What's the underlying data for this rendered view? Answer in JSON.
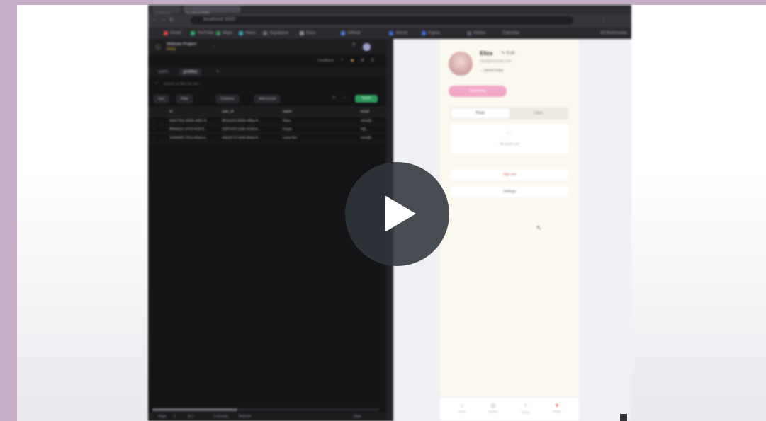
{
  "browser": {
    "address": "localhost:3000",
    "tabs": [
      "supabase",
      "localhost:3000"
    ],
    "bookmarks": [
      "Gmail",
      "YouTube",
      "Maps",
      "News",
      "Supabase",
      "Docs",
      "GitHub",
      "Vercel",
      "Figma",
      "Notion",
      "Calendar"
    ],
    "bookmarks_more": "All Bookmarks"
  },
  "left_panel": {
    "project_title": "Website Project",
    "project_sub": "FREE",
    "subbar_label": "Feedback",
    "tabs": [
      "users",
      "profiles"
    ],
    "active_tab": "profiles",
    "filter_placeholder": "Search or filter by row...",
    "toolbar": {
      "sort": "Sort",
      "filter": "Filter",
      "columns": "Columns",
      "add_record": "Add record",
      "insert": "Insert"
    },
    "table": {
      "columns": [
        "id",
        "user_id",
        "name",
        "email"
      ],
      "rows": [
        [
          "6a9c79e1-80b5-4d61-8...",
          "9f32a1d1-8d0b-49ba-9...",
          "Eliza",
          "eliza@..."
        ],
        [
          "8f9d4a2c-b7e3-4c3f-9...",
          "2b5f7e03-1a8e-4c6d-b...",
          "Kaiya",
          "k@..."
        ],
        [
          "3c84e6f2-7d1a-42a3-a...",
          "d4a1b7c2-9e6f-4b0a-8...",
          "Luna Rei",
          "luna@..."
        ]
      ]
    },
    "footer": {
      "page": "Page",
      "page_num": "1",
      "of": "of 1",
      "records": "3 records",
      "refresh": "Refresh",
      "view": "Data"
    }
  },
  "phone": {
    "name": "Eliza",
    "edit_label": "✎ Edit",
    "email": "eliza@example.com",
    "tag": "♀ Joined today",
    "pink_button": "Edit Profile",
    "segments": [
      "Posts",
      "Likes"
    ],
    "active_segment": "Posts",
    "empty_icon": "□",
    "empty_text": "No posts yet",
    "list_buttons": [
      "Sign out",
      "Settings"
    ],
    "nav": [
      {
        "icon": "⌂",
        "label": "Home"
      },
      {
        "icon": "◎",
        "label": "Explore"
      },
      {
        "icon": "⌕",
        "label": "Search"
      },
      {
        "icon": "●",
        "label": "Profile"
      }
    ]
  },
  "colors": {
    "accent_green": "#2f9a5a",
    "accent_pink": "#f4a6c8",
    "danger_text": "#d9534f"
  }
}
